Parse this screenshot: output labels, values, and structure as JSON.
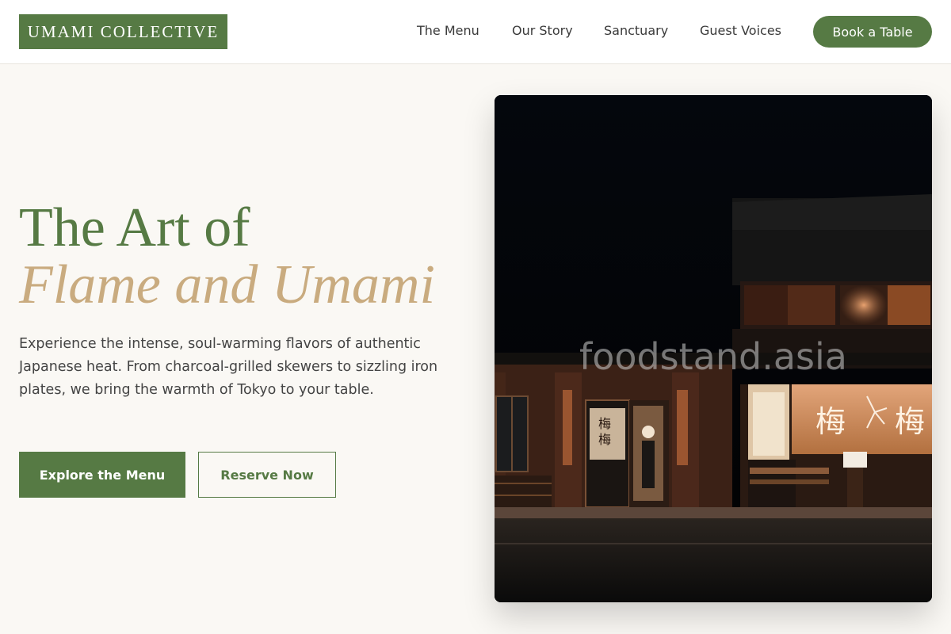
{
  "header": {
    "logo": "UMAMI COLLECTIVE",
    "nav": [
      "The Menu",
      "Our Story",
      "Sanctuary",
      "Guest Voices"
    ],
    "cta": "Book a Table"
  },
  "hero": {
    "title_line1": "The Art of",
    "title_line2": "Flame and Umami",
    "description": "Experience the intense, soul-warming flavors of authentic Japanese heat. From charcoal-grilled skewers to sizzling iron plates, we bring the warmth of Tokyo to your table.",
    "primary_button": "Explore the Menu",
    "secondary_button": "Reserve Now"
  },
  "image": {
    "watermark": "foodstand.asia",
    "sign_text": "梅",
    "subject": "night-storefront-photo"
  },
  "colors": {
    "brand_green": "#567a44",
    "accent_tan": "#c9ab7f",
    "background": "#faf8f4"
  }
}
